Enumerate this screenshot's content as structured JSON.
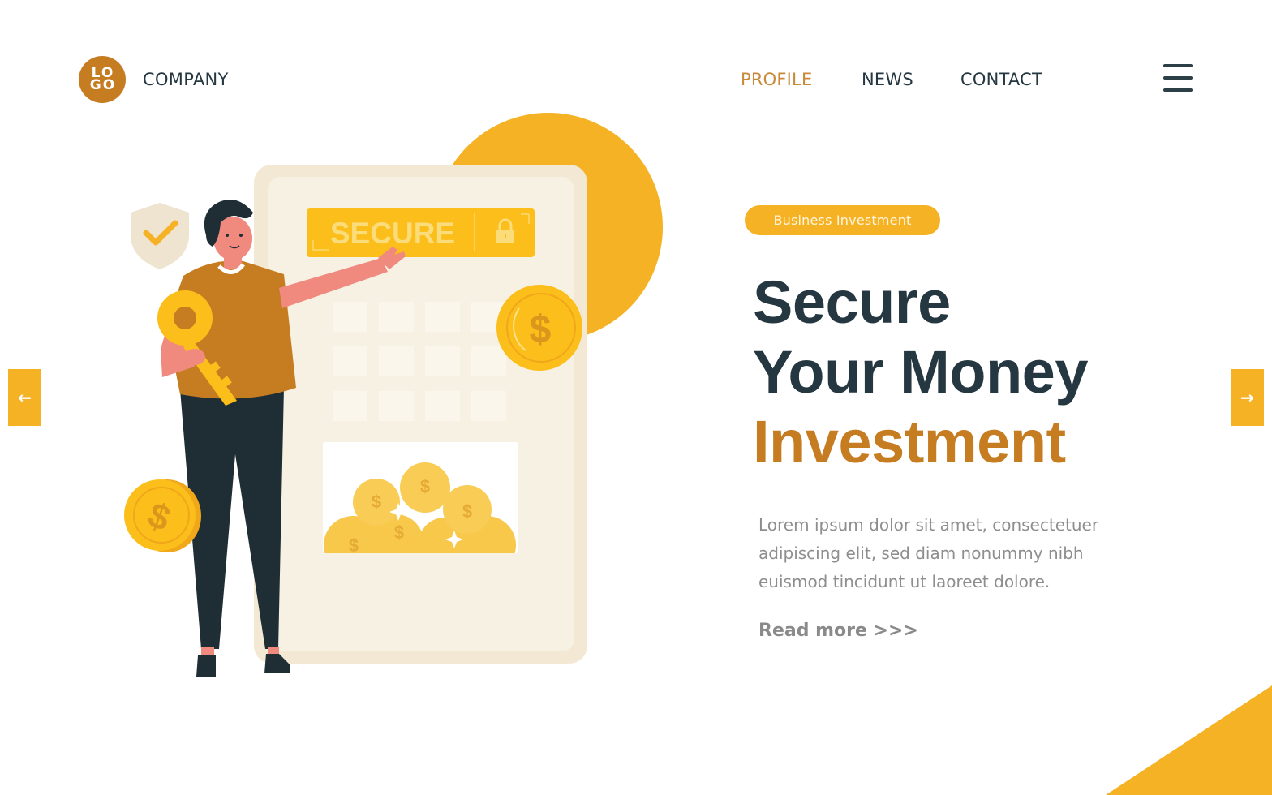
{
  "header": {
    "logo_text_top": "LO",
    "logo_text_bottom": "GO",
    "company": "COMPANY",
    "nav": [
      {
        "label": "PROFILE",
        "active": true
      },
      {
        "label": "NEWS",
        "active": false
      },
      {
        "label": "CONTACT",
        "active": false
      }
    ],
    "menu_icon": "hamburger-menu-icon"
  },
  "carousel": {
    "prev_icon": "←",
    "next_icon": "→"
  },
  "hero": {
    "badge": "Business Investment",
    "title_line1": "Secure",
    "title_line2": "Your Money",
    "title_line3": "Investment",
    "description": "Lorem ipsum dolor sit amet, consectetuer adipiscing elit, sed diam nonummy nibh euismod tincidunt ut laoreet dolore.",
    "read_more": "Read more >>>"
  },
  "illustration": {
    "screen_label": "SECURE",
    "coin_symbol": "$"
  },
  "colors": {
    "accent_yellow": "#f6b225",
    "accent_orange": "#c67d22",
    "dark": "#253740",
    "text_gray": "#8e8e8e"
  }
}
